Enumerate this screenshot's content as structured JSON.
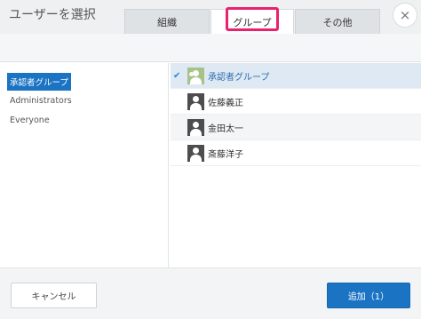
{
  "dialog": {
    "title": "ユーザーを選択",
    "close_symbol": "×"
  },
  "tabs": [
    {
      "label": "組織",
      "active": false
    },
    {
      "label": "グループ",
      "active": true
    },
    {
      "label": "その他",
      "active": false
    }
  ],
  "left_list": [
    {
      "label": "承認者グループ",
      "selected": true
    },
    {
      "label": "Administrators",
      "selected": false
    },
    {
      "label": "Everyone",
      "selected": false
    }
  ],
  "right_list": [
    {
      "label": "承認者グループ",
      "selected": true,
      "icon": "group-icon"
    },
    {
      "label": "佐藤義正",
      "selected": false,
      "icon": "user-icon"
    },
    {
      "label": "金田太一",
      "selected": false,
      "icon": "user-icon"
    },
    {
      "label": "斎藤洋子",
      "selected": false,
      "icon": "user-icon"
    }
  ],
  "footer": {
    "cancel_label": "キャンセル",
    "add_label": "追加（1）"
  },
  "colors": {
    "accent": "#1b73c3",
    "highlight": "#e8226c",
    "group_avatar": "#a7c289"
  },
  "check_symbol": "✔"
}
